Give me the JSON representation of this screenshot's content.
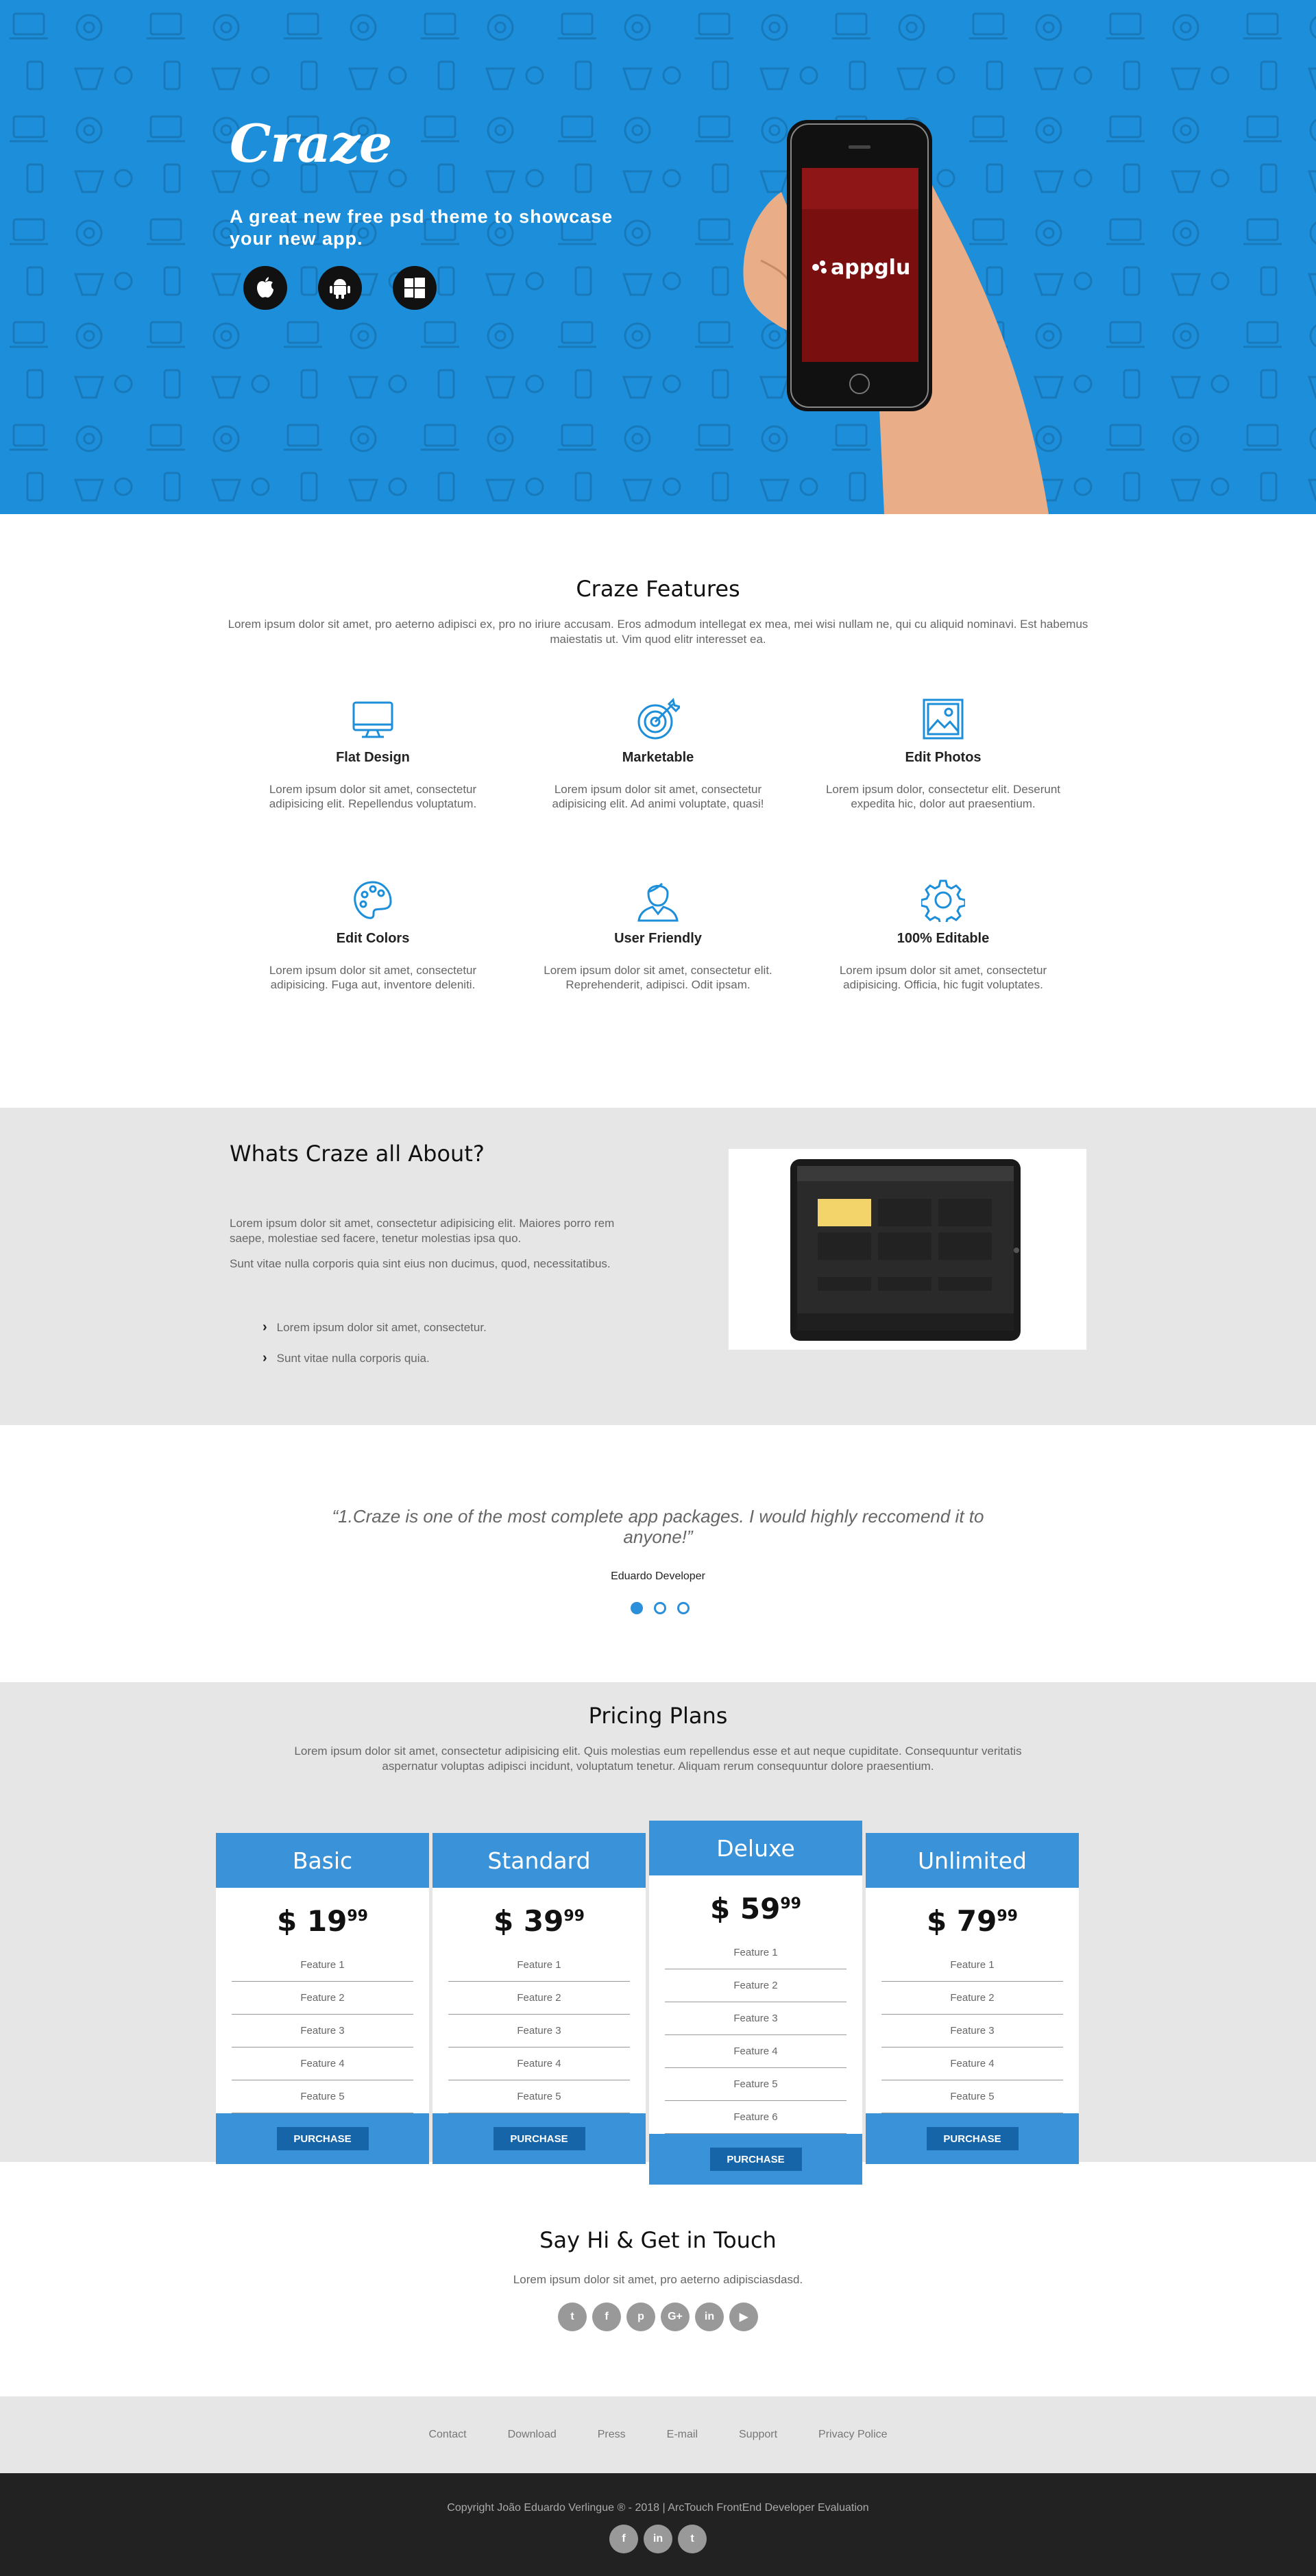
{
  "hero": {
    "logo": "Craze",
    "tagline": "A great new free psd theme to showcase your new app.",
    "stores": [
      {
        "icon": "apple-icon"
      },
      {
        "icon": "android-icon"
      },
      {
        "icon": "windows-icon"
      }
    ],
    "phone_screen_text": "appglu",
    "bg_color": "#1d8ed9"
  },
  "features": {
    "title": "Craze Features",
    "lead": "Lorem ipsum dolor sit amet, pro aeterno adipisci ex, pro no iriure accusam. Eros admodum intellegat ex mea, mei wisi nullam ne, qui cu aliquid nominavi. Est habemus maiestatis ut. Vim quod elitr interesset ea.",
    "items": [
      {
        "icon": "monitor-icon",
        "title": "Flat Design",
        "desc": "Lorem ipsum dolor sit amet, consectetur adipisicing elit. Repellendus voluptatum."
      },
      {
        "icon": "target-icon",
        "title": "Marketable",
        "desc": "Lorem ipsum dolor sit amet, consectetur adipisicing elit. Ad animi voluptate, quasi!"
      },
      {
        "icon": "photo-icon",
        "title": "Edit Photos",
        "desc": "Lorem ipsum dolor, consectetur elit. Deserunt expedita hic, dolor aut praesentium."
      },
      {
        "icon": "palette-icon",
        "title": "Edit Colors",
        "desc": "Lorem ipsum dolor sit amet, consectetur adipisicing. Fuga aut, inventore deleniti."
      },
      {
        "icon": "user-icon",
        "title": "User Friendly",
        "desc": "Lorem ipsum dolor sit amet, consectetur elit. Reprehenderit, adipisci. Odit ipsam."
      },
      {
        "icon": "gear-icon",
        "title": "100% Editable",
        "desc": "Lorem ipsum dolor sit amet, consectetur adipisicing. Officia, hic fugit voluptates."
      }
    ],
    "accent": "#1d8ed9"
  },
  "about": {
    "title": "Whats Craze all About?",
    "p1": "Lorem ipsum dolor sit amet, consectetur adipisicing elit. Maiores porro rem saepe, molestiae sed facere, tenetur molestias ipsa quo.",
    "p2": "Sunt vitae nulla corporis quia sint eius non ducimus, quod, necessitatibus.",
    "bullets": [
      "Lorem ipsum dolor sit amet, consectetur.",
      "Sunt vitae nulla corporis quia."
    ]
  },
  "testimonial": {
    "quote": "“1.Craze is one of the most complete app packages. I would highly reccomend it to anyone!”",
    "author": "Eduardo Developer",
    "active_slide": 1,
    "slides_count": 3
  },
  "pricing": {
    "title": "Pricing Plans",
    "lead": "Lorem ipsum dolor sit amet, consectetur adipisicing elit. Quis molestias eum repellendus esse et aut neque cupiditate. Consequuntur veritatis aspernatur voluptas adipisci incidunt, voluptatum tenetur. Aliquam rerum consequuntur dolore praesentium.",
    "plans": [
      {
        "name": "Basic",
        "price": "$ 19",
        "cents": "99",
        "features": [
          "Feature 1",
          "Feature 2",
          "Feature 3",
          "Feature 4",
          "Feature 5"
        ],
        "button": "PURCHASE"
      },
      {
        "name": "Standard",
        "price": "$ 39",
        "cents": "99",
        "features": [
          "Feature 1",
          "Feature 2",
          "Feature 3",
          "Feature 4",
          "Feature 5"
        ],
        "button": "PURCHASE"
      },
      {
        "name": "Deluxe",
        "price": "$ 59",
        "cents": "99",
        "features": [
          "Feature 1",
          "Feature 2",
          "Feature 3",
          "Feature 4",
          "Feature 5",
          "Feature 6"
        ],
        "button": "PURCHASE",
        "featured": true
      },
      {
        "name": "Unlimited",
        "price": "$ 79",
        "cents": "99",
        "features": [
          "Feature 1",
          "Feature 2",
          "Feature 3",
          "Feature 4",
          "Feature 5"
        ],
        "button": "PURCHASE"
      }
    ],
    "accent": "#3a93d8"
  },
  "contact": {
    "title": "Say Hi & Get in Touch",
    "lead": "Lorem ipsum dolor sit amet, pro aeterno adipisciasdasd.",
    "socials": [
      {
        "icon": "twitter-icon",
        "glyph": "t"
      },
      {
        "icon": "facebook-icon",
        "glyph": "f"
      },
      {
        "icon": "pinterest-icon",
        "glyph": "p"
      },
      {
        "icon": "google-plus-icon",
        "glyph": "G+"
      },
      {
        "icon": "linkedin-icon",
        "glyph": "in"
      },
      {
        "icon": "youtube-icon",
        "glyph": "▶"
      }
    ]
  },
  "footer": {
    "links": [
      "Contact",
      "Download",
      "Press",
      "E-mail",
      "Support",
      "Privacy Police"
    ],
    "copyright": "Copyright João Eduardo Verlingue ® - 2018 | ArcTouch FrontEnd Developer Evaluation",
    "socials": [
      {
        "icon": "facebook-icon",
        "glyph": "f"
      },
      {
        "icon": "linkedin-icon",
        "glyph": "in"
      },
      {
        "icon": "twitter-icon",
        "glyph": "t"
      }
    ]
  }
}
